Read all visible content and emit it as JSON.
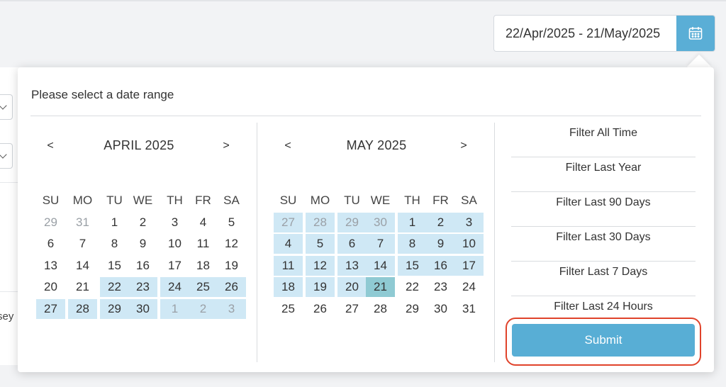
{
  "date_field": {
    "value": "22/Apr/2025 - 21/May/2025",
    "icon": "calendar-icon"
  },
  "left_partial_text": "sey",
  "popup": {
    "title": "Please select a date range"
  },
  "calendars": [
    {
      "prev": "<",
      "next": ">",
      "title": "APRIL 2025",
      "weekdays": [
        "SU",
        "MO",
        "TU",
        "WE",
        "TH",
        "FR",
        "SA"
      ],
      "weeks": [
        [
          "29",
          "31",
          "1",
          "2",
          "3",
          "4",
          "5"
        ],
        [
          "6",
          "7",
          "8",
          "9",
          "10",
          "11",
          "12"
        ],
        [
          "13",
          "14",
          "15",
          "16",
          "17",
          "18",
          "19"
        ],
        [
          "20",
          "21",
          "22",
          "23",
          "24",
          "25",
          "26"
        ],
        [
          "27",
          "28",
          "29",
          "30",
          "1",
          "2",
          "3"
        ]
      ]
    },
    {
      "prev": "<",
      "next": ">",
      "title": "MAY 2025",
      "weekdays": [
        "SU",
        "MO",
        "TU",
        "WE",
        "TH",
        "FR",
        "SA"
      ],
      "weeks": [
        [
          "27",
          "28",
          "29",
          "30",
          "1",
          "2",
          "3"
        ],
        [
          "4",
          "5",
          "6",
          "7",
          "8",
          "9",
          "10"
        ],
        [
          "11",
          "12",
          "13",
          "14",
          "15",
          "16",
          "17"
        ],
        [
          "18",
          "19",
          "20",
          "21",
          "22",
          "23",
          "24"
        ],
        [
          "25",
          "26",
          "27",
          "28",
          "29",
          "30",
          "31"
        ]
      ]
    }
  ],
  "presets": [
    "Filter All Time",
    "Filter Last Year",
    "Filter Last 90 Days",
    "Filter Last 30 Days",
    "Filter Last 7 Days",
    "Filter Last 24 Hours"
  ],
  "submit_label": "Submit",
  "colors": {
    "accent": "#5aaed6",
    "range_highlight": "#cfe8f5",
    "end_date_highlight": "#8fcad3",
    "annotation": "#e0432b"
  }
}
